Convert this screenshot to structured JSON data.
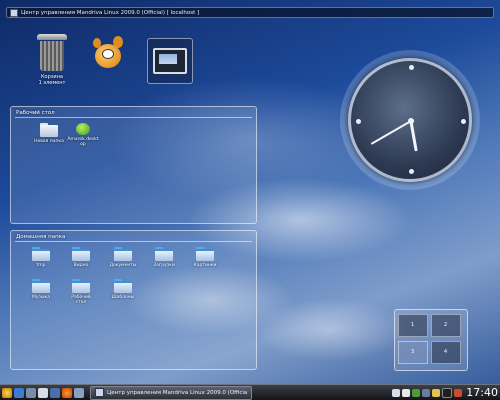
{
  "active_window": {
    "title": "Центр управления Mandriva Linux 2009.0 (Official) [ localhost ]"
  },
  "desktop_icons": [
    {
      "label_line1": "Корзина",
      "label_line2": "1 элемент",
      "icon": "trash-icon"
    },
    {
      "label_line1": "",
      "label_line2": "",
      "icon": "gimp-icon"
    }
  ],
  "desktop_panel": {
    "title": "Рабочий стол",
    "items": [
      {
        "label": "Новая папка",
        "icon": "folder-icon"
      },
      {
        "label_line1": "Amarok.deskt",
        "label_line2": "op",
        "icon": "amarok-icon"
      }
    ]
  },
  "home_panel": {
    "title": "Домашняя папка",
    "items": [
      {
        "label": "tmp"
      },
      {
        "label": "Видео"
      },
      {
        "label": "Документы"
      },
      {
        "label": "Загрузки"
      },
      {
        "label": "Картинки"
      },
      {
        "label": "Музыка"
      },
      {
        "label_line1": "Рабочий",
        "label_line2": "стол"
      },
      {
        "label": "Шаблоны"
      }
    ]
  },
  "pager": {
    "desktops": [
      "1",
      "2",
      "3",
      "4"
    ],
    "active": "3"
  },
  "clock": {
    "hours": 5,
    "minutes": 40
  },
  "taskbar": {
    "task_label": "Центр управления Mandriva Linux 2009.0 (Officia",
    "time": "17:40"
  }
}
